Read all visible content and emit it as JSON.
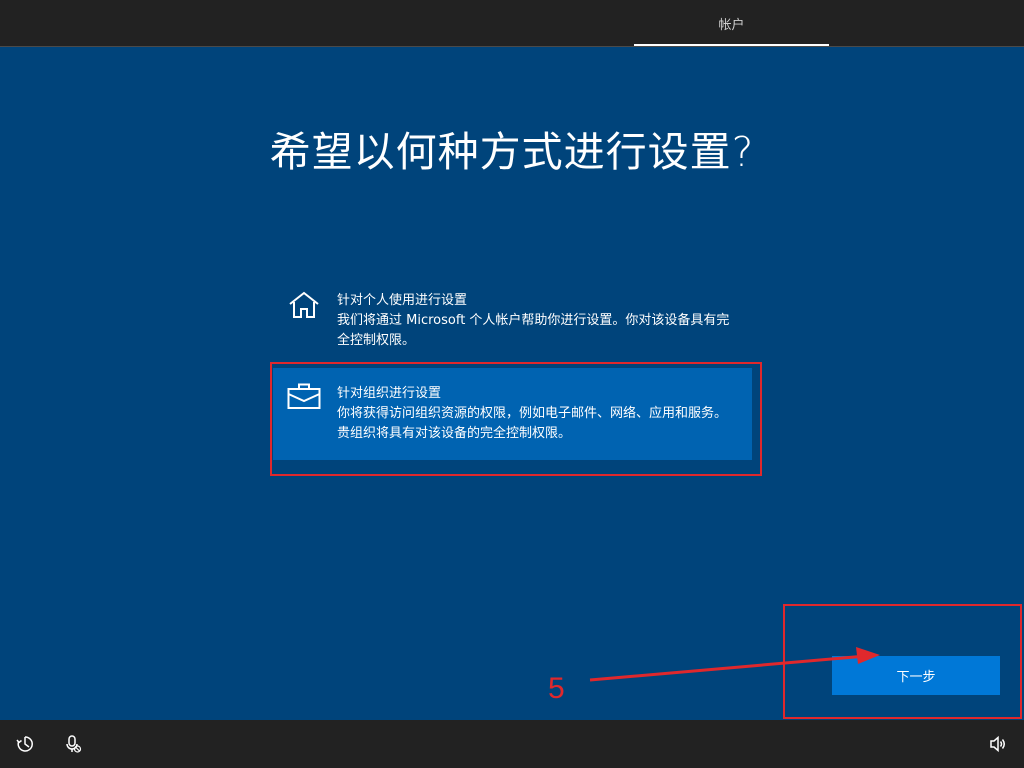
{
  "header": {
    "tab_label": "帐户"
  },
  "main": {
    "title": "希望以何种方式进行设置?",
    "options": [
      {
        "icon": "home-icon",
        "title": "针对个人使用进行设置",
        "description": "我们将通过 Microsoft 个人帐户帮助你进行设置。你对该设备具有完全控制权限。"
      },
      {
        "icon": "briefcase-icon",
        "title": "针对组织进行设置",
        "description": "你将获得访问组织资源的权限，例如电子邮件、网络、应用和服务。贵组织将具有对该设备的完全控制权限。"
      }
    ],
    "next_label": "下一步"
  },
  "annotation": {
    "step_number": "5",
    "color": "#e0282c"
  },
  "bottom_bar": {
    "icons": [
      "ease-of-access-icon",
      "microphone-off-icon",
      "volume-icon"
    ]
  }
}
